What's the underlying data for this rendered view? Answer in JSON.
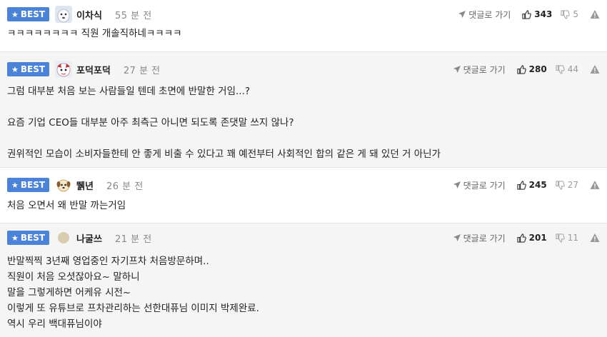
{
  "comments": [
    {
      "badge": "BEST",
      "nick": "이차식",
      "time": "55 분 전",
      "reply_label": "댓글로 가기",
      "likes": "343",
      "dislikes": "5",
      "lines": [
        "ㅋㅋㅋㅋㅋㅋㅋㅋ 직원 개솔직하네ㅋㅋㅋㅋ"
      ]
    },
    {
      "badge": "BEST",
      "nick": "포덕포덕",
      "time": "27 분 전",
      "reply_label": "댓글로 가기",
      "likes": "280",
      "dislikes": "44",
      "lines": [
        "그럼 대부분 처음 보는 사람들일 텐데 초면에 반말한 거임...?",
        "요즘 기업 CEO들 대부분 아주 최측근 아니면 되도록 존댓말 쓰지 않나?",
        "권위적인 모습이 소비자들한테 안 좋게 비출 수 있다고 꽤 예전부터 사회적인 합의 같은 게 돼 있던 거 아닌가"
      ]
    },
    {
      "badge": "BEST",
      "nick": "뛝년",
      "time": "26 분 전",
      "reply_label": "댓글로 가기",
      "likes": "245",
      "dislikes": "27",
      "lines": [
        "처음 오면서 왜 반말 까는거임"
      ]
    },
    {
      "badge": "BEST",
      "nick": "나굴쓰",
      "time": "21 분 전",
      "reply_label": "댓글로 가기",
      "likes": "201",
      "dislikes": "11",
      "lines": [
        "반말찍찍 3년째 영업중인 자기프차 처음방문하며..",
        "직원이 처음 오셧잖아요~ 말하니",
        "말을 그렇게하면 어케유 시전~",
        "이렇게 또 유튜브로 프차관리하는 선한대퓨님 이미지 박제완료.",
        "역시 우리 백대퓨님이야"
      ]
    }
  ],
  "colors": {
    "badge_bg": "#4b83d9",
    "alt_row_bg": "#f5f5f5"
  }
}
